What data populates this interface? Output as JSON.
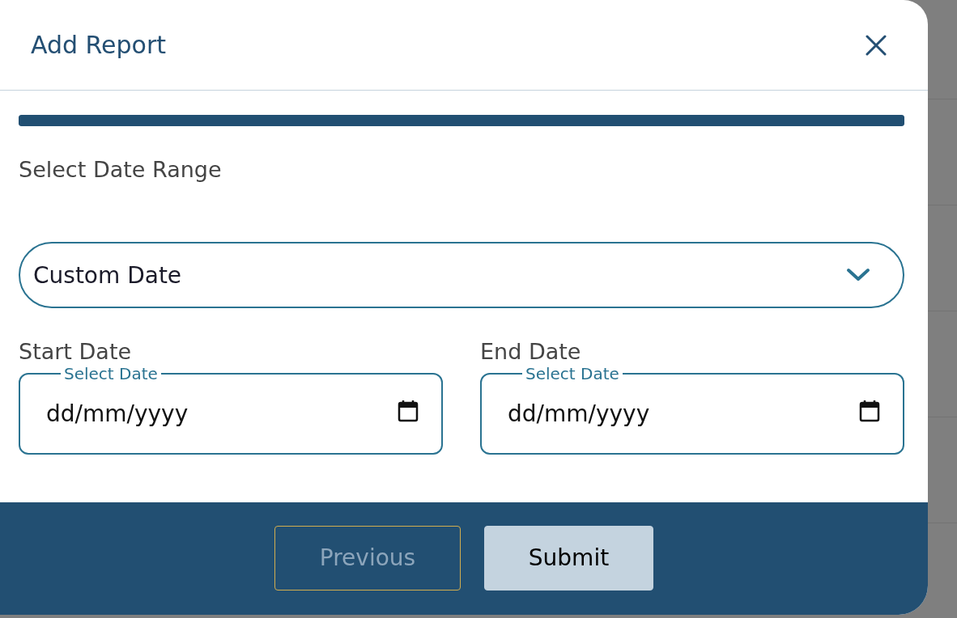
{
  "dialog": {
    "title": "Add Report"
  },
  "progress": {
    "level": 1
  },
  "section_label": "Select Date Range",
  "range_select": {
    "value": "Custom Date"
  },
  "date_fields": [
    {
      "label": "Start Date",
      "legend": "Select Date",
      "placeholder": "dd/mm/yyyy"
    },
    {
      "label": "End Date",
      "legend": "Select Date",
      "placeholder": "dd/mm/yyyy"
    }
  ],
  "buttons": [
    {
      "label": "Previous",
      "kind": "secondary",
      "disabled": true
    },
    {
      "label": "Submit",
      "kind": "primary",
      "disabled": false
    }
  ]
}
